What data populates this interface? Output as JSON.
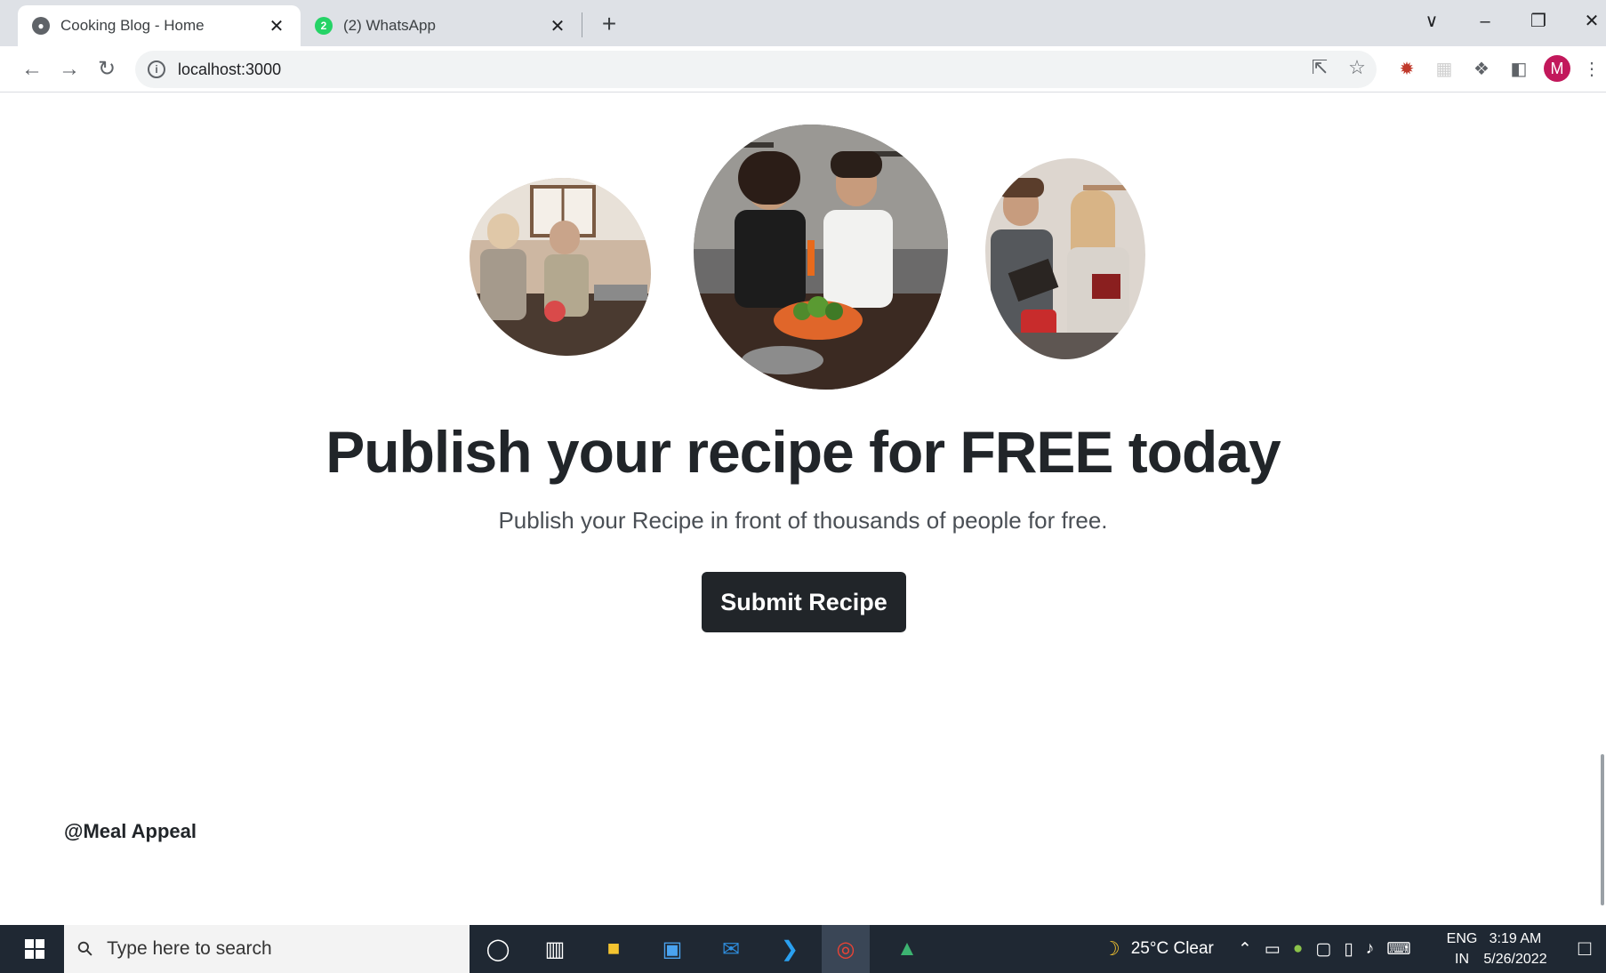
{
  "browser": {
    "tabs": [
      {
        "title": "Cooking Blog - Home",
        "favicon": "globe-icon",
        "active": true
      },
      {
        "title": "(2) WhatsApp",
        "favicon": "whatsapp-icon",
        "badge": "2",
        "active": false
      }
    ],
    "url": "localhost:3000",
    "profile_initial": "M"
  },
  "hero": {
    "images": [
      {
        "name": "couple-washing-dishes-photo"
      },
      {
        "name": "couple-cooking-vegetables-photo"
      },
      {
        "name": "couple-reading-recipe-photo"
      }
    ]
  },
  "cta": {
    "headline": "Publish your recipe for FREE today",
    "subline": "Publish your Recipe in front of thousands of people for free.",
    "button_label": "Submit Recipe"
  },
  "footer": {
    "brand": "@Meal Appeal"
  },
  "taskbar": {
    "search_placeholder": "Type here to search",
    "weather": "25°C  Clear",
    "lang_line1": "ENG",
    "lang_line2": "IN",
    "time": "3:19 AM",
    "date": "5/26/2022"
  },
  "colors": {
    "button_bg": "#212529",
    "headline": "#212529",
    "taskbar_bg": "#1f2833",
    "tabstrip_bg": "#dee1e6"
  }
}
